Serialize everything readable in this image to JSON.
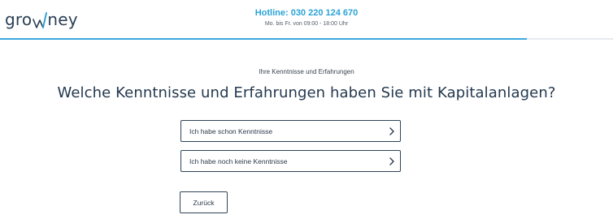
{
  "header": {
    "logo": {
      "text_before": "gro",
      "text_after": "ney",
      "brand_color": "#2aa3d6",
      "text_color": "#2a3f55"
    },
    "hotline": {
      "number": "Hotline: 030 220 124 670",
      "hours": "Mo. bis Fr. von 09:00 - 18:00 Uhr"
    },
    "progress": {
      "fraction": 0.86,
      "color": "#3aa8e0"
    }
  },
  "main": {
    "step_label": "Ihre Kenntnisse und Erfahrungen",
    "question": "Welche Kenntnisse und Erfahrungen haben Sie mit Kapitalanlagen?",
    "options": [
      {
        "label": "Ich habe schon Kenntnisse",
        "icon": "chevron-right-icon"
      },
      {
        "label": "Ich habe noch keine Kenntnisse",
        "icon": "chevron-right-icon"
      }
    ],
    "back_label": "Zurück"
  }
}
